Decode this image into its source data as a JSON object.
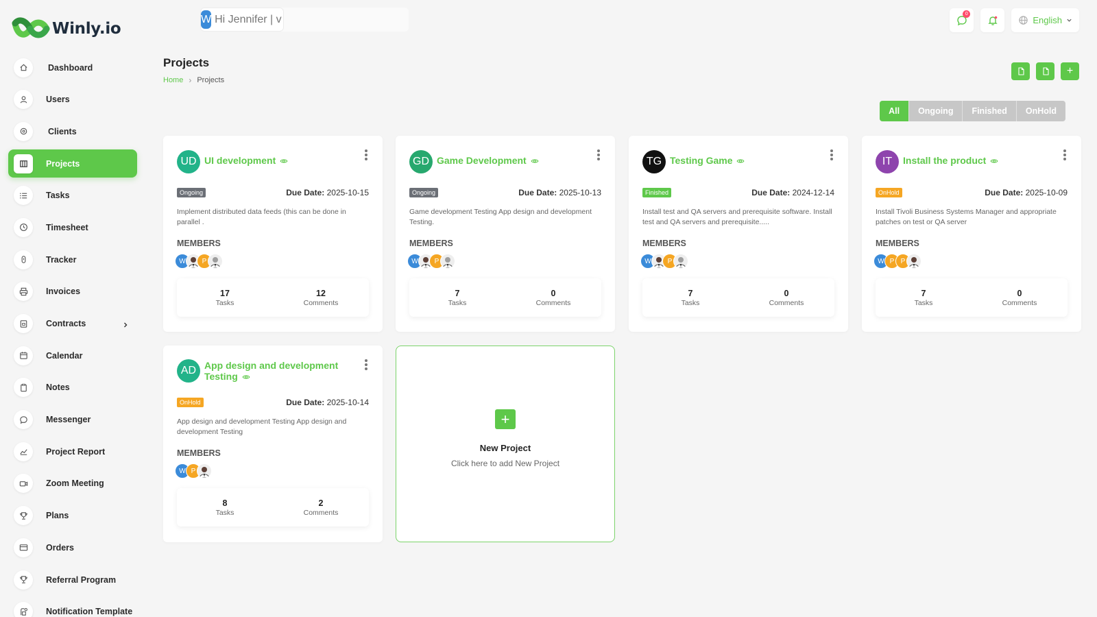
{
  "brand": {
    "name": "Winly.io",
    "logo_text": "Winly.io"
  },
  "topbar": {
    "avatar_letter": "W",
    "greeting": "Hi Jennifer | v",
    "messages_badge": "0",
    "language": "English"
  },
  "sidebar": {
    "items": [
      {
        "label": "Dashboard",
        "icon": "home-icon",
        "active": false
      },
      {
        "label": "Users",
        "icon": "user-icon",
        "active": false
      },
      {
        "label": "Clients",
        "icon": "clients-icon",
        "active": false
      },
      {
        "label": "Projects",
        "icon": "projects-icon",
        "active": true
      },
      {
        "label": "Tasks",
        "icon": "list-icon",
        "active": false
      },
      {
        "label": "Timesheet",
        "icon": "clock-icon",
        "active": false
      },
      {
        "label": "Tracker",
        "icon": "tracker-icon",
        "active": false
      },
      {
        "label": "Invoices",
        "icon": "printer-icon",
        "active": false
      },
      {
        "label": "Contracts",
        "icon": "contract-icon",
        "active": false,
        "has_submenu": true
      },
      {
        "label": "Calendar",
        "icon": "calendar-icon",
        "active": false
      },
      {
        "label": "Notes",
        "icon": "clipboard-icon",
        "active": false
      },
      {
        "label": "Messenger",
        "icon": "chat-icon",
        "active": false
      },
      {
        "label": "Project Report",
        "icon": "chart-icon",
        "active": false
      },
      {
        "label": "Zoom Meeting",
        "icon": "video-icon",
        "active": false
      },
      {
        "label": "Plans",
        "icon": "trophy-icon",
        "active": false
      },
      {
        "label": "Orders",
        "icon": "card-icon",
        "active": false
      },
      {
        "label": "Referral Program",
        "icon": "trophy-icon",
        "active": false
      },
      {
        "label": "Notification Template",
        "icon": "notification-icon",
        "active": false
      }
    ]
  },
  "header": {
    "title": "Projects",
    "breadcrumb": {
      "home": "Home",
      "separator": "›",
      "current": "Projects"
    }
  },
  "actions": {
    "add": "+"
  },
  "filters": {
    "tabs": [
      "All",
      "Ongoing",
      "Finished",
      "OnHold"
    ],
    "active": "All"
  },
  "colors": {
    "accent": "#5ec84a",
    "ongoing": "#6b6f76",
    "finished": "#5ec84a",
    "onhold": "#f5a623"
  },
  "projects": [
    {
      "initials": "UD",
      "avatar_color": "#22b389",
      "title": "UI development",
      "status": "Ongoing",
      "status_color": "#6b6f76",
      "due_label": "Due Date:",
      "due_date": "2025-10-15",
      "description": "Implement distributed data feeds (this can be done in parallel .",
      "members_label": "MEMBERS",
      "members": [
        "W",
        "photo",
        "P",
        "photo"
      ],
      "tasks": "17",
      "tasks_label": "Tasks",
      "comments": "12",
      "comments_label": "Comments"
    },
    {
      "initials": "GD",
      "avatar_color": "#27a86e",
      "title": "Game Development",
      "status": "Ongoing",
      "status_color": "#6b6f76",
      "due_label": "Due Date:",
      "due_date": "2025-10-13",
      "description": "Game development Testing App design and development Testing.",
      "members_label": "MEMBERS",
      "members": [
        "W",
        "photo",
        "P",
        "photo"
      ],
      "tasks": "7",
      "tasks_label": "Tasks",
      "comments": "0",
      "comments_label": "Comments"
    },
    {
      "initials": "TG",
      "avatar_color": "#111111",
      "title": "Testing Game",
      "status": "Finished",
      "status_color": "#5ec84a",
      "due_label": "Due Date:",
      "due_date": "2024-12-14",
      "description": "Install test and QA servers and prerequisite software. Install test and QA servers and prerequisite.....",
      "members_label": "MEMBERS",
      "members": [
        "W",
        "photo",
        "P",
        "photo"
      ],
      "tasks": "7",
      "tasks_label": "Tasks",
      "comments": "0",
      "comments_label": "Comments"
    },
    {
      "initials": "IT",
      "avatar_color": "#8e44ad",
      "title": "Install the product",
      "status": "OnHold",
      "status_color": "#f5a623",
      "due_label": "Due Date:",
      "due_date": "2025-10-09",
      "description": "Install Tivoli Business Systems Manager and appropriate patches on test or QA server",
      "members_label": "MEMBERS",
      "members": [
        "W",
        "P",
        "P",
        "photo"
      ],
      "tasks": "7",
      "tasks_label": "Tasks",
      "comments": "0",
      "comments_label": "Comments"
    },
    {
      "initials": "AD",
      "avatar_color": "#22b389",
      "title": "App design and development Testing",
      "status": "OnHold",
      "status_color": "#f5a623",
      "due_label": "Due Date:",
      "due_date": "2025-10-14",
      "description": "App design and development Testing App design and development Testing",
      "members_label": "MEMBERS",
      "members": [
        "W",
        "P",
        "photo"
      ],
      "tasks": "8",
      "tasks_label": "Tasks",
      "comments": "2",
      "comments_label": "Comments"
    }
  ],
  "new_project": {
    "plus": "+",
    "title": "New Project",
    "subtitle": "Click here to add New Project"
  }
}
